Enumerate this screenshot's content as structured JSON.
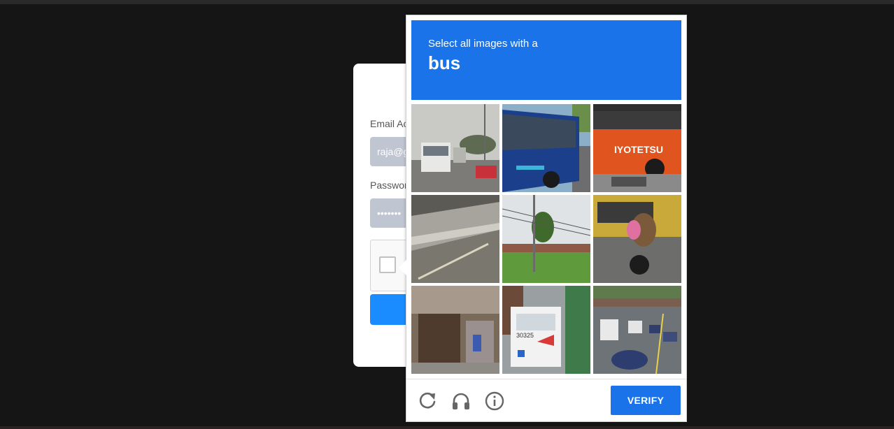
{
  "login": {
    "email_label": "Email Ac",
    "email_value": "raja@g",
    "password_label": "Passwor",
    "password_value": "•••••••"
  },
  "challenge": {
    "instruction_line1": "Select all images with a",
    "target_word": "bus",
    "verify_label": "VERIFY",
    "tiles": [
      "street-white-bus",
      "blue-bus-side",
      "orange-iyotetsu-bus",
      "highway-guardrail",
      "power-lines-field",
      "motorcycle-riders-yellow-bus",
      "storefront-street",
      "white-bus-rear",
      "traffic-jam-bridge"
    ],
    "icons": [
      "reload-icon",
      "audio-icon",
      "info-icon"
    ],
    "colors": {
      "header_blue": "#1a73e8",
      "button_blue": "#1a73e8"
    }
  }
}
